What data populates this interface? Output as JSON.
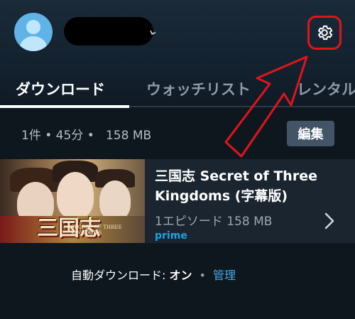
{
  "header": {
    "avatar_icon": "user-avatar-icon",
    "settings_icon": "gear-icon",
    "highlight_color": "#e0141e"
  },
  "tabs": [
    {
      "label": "ダウンロード",
      "active": true
    },
    {
      "label": "ウォッチリスト",
      "active": false
    },
    {
      "label": "レンタル",
      "active": false
    }
  ],
  "summary": {
    "count": "1件",
    "duration": "45分",
    "size": "158 MB"
  },
  "edit_label": "編集",
  "downloads": [
    {
      "title": "三国志 Secret of Three Kingdoms (字幕版)",
      "meta": "1エピソード 158 MB",
      "badge": "prime",
      "thumbnail_logo": "三国志",
      "thumbnail_subtitle": "SECRET OF THREE KINGDOMS"
    }
  ],
  "auto_download": {
    "label": "自動ダウンロード: ",
    "state": "オン",
    "manage": "管理"
  },
  "colors": {
    "background": "#0f171e",
    "accent": "#1aa3e0",
    "link": "#4aa8e8"
  }
}
